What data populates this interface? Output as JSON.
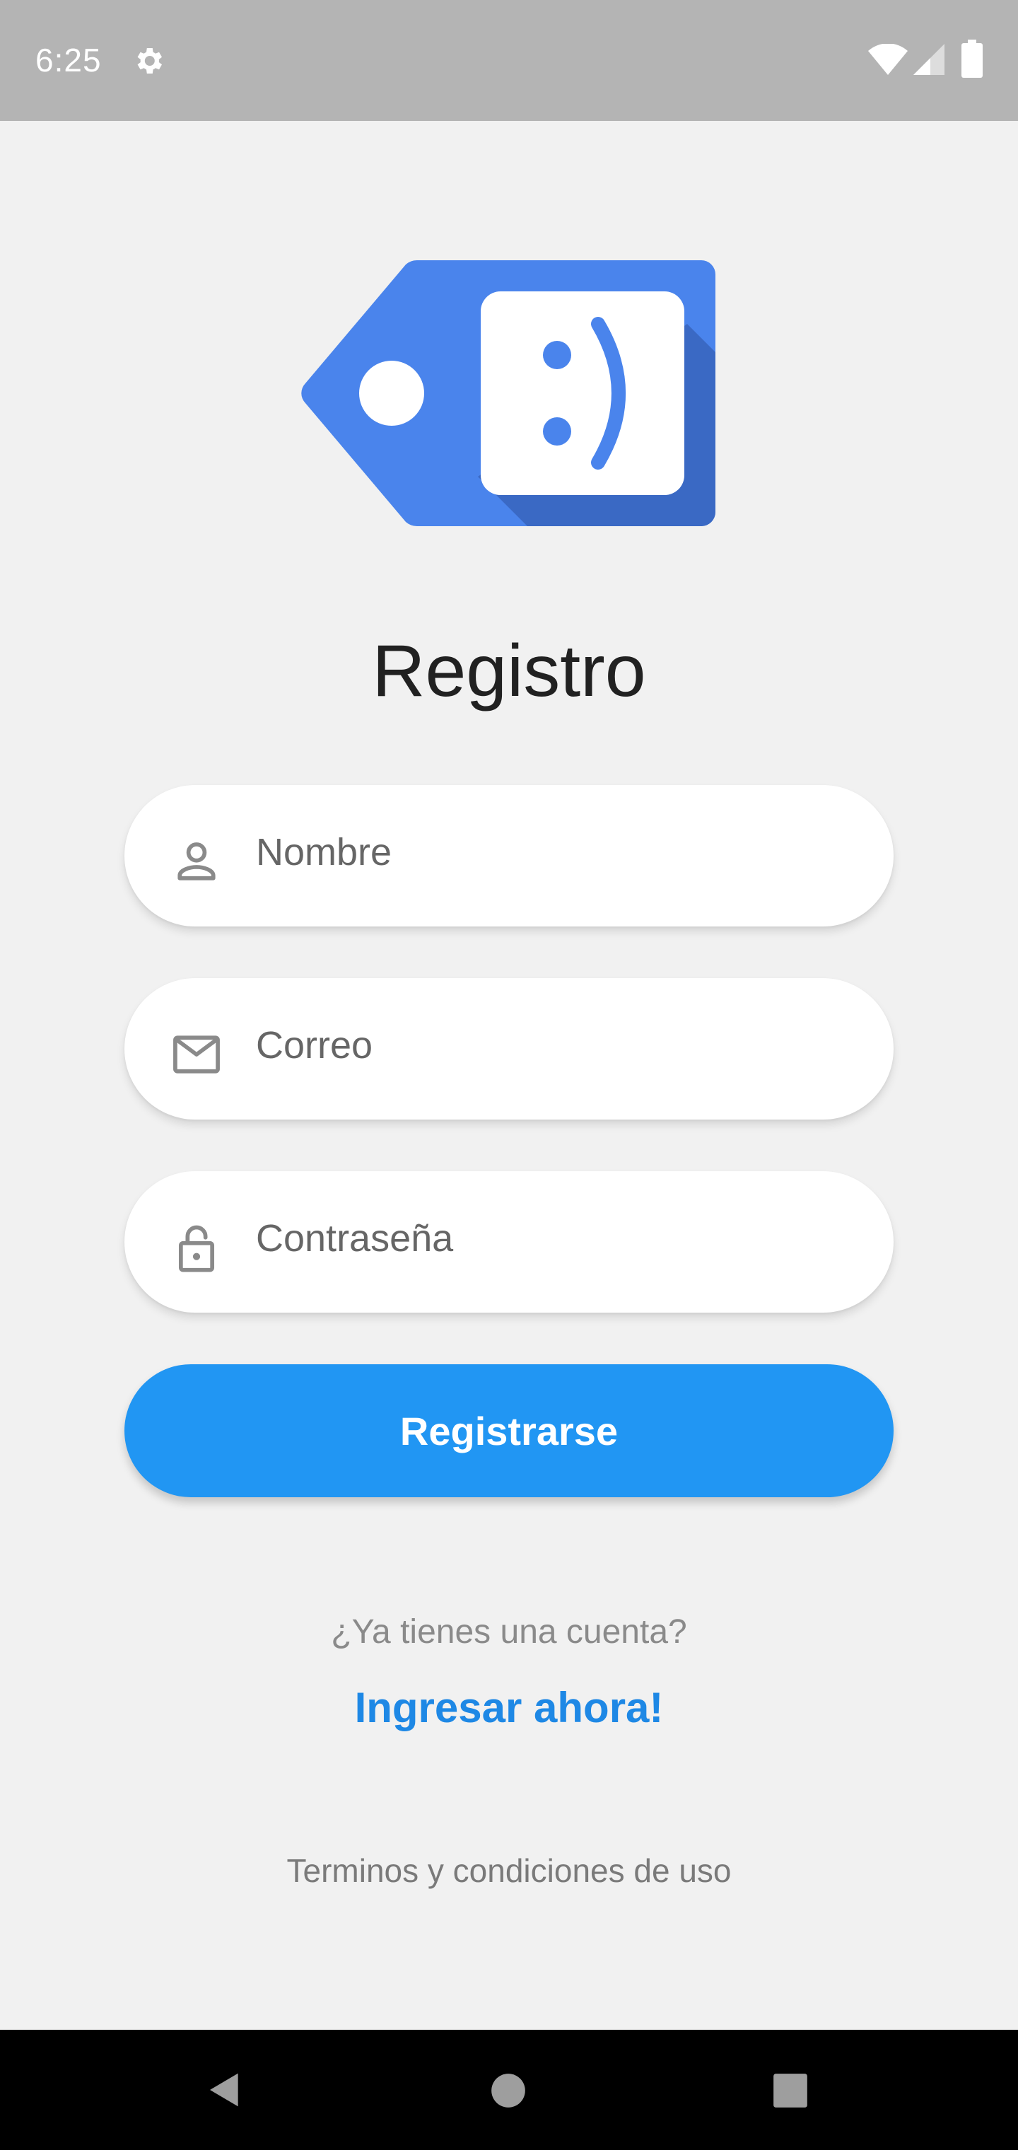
{
  "status_bar": {
    "time": "6:25",
    "icons": [
      "gear-icon",
      "wifi-icon",
      "cell-signal-icon",
      "battery-icon"
    ]
  },
  "logo": {
    "icon": "tag-smiley-logo-icon",
    "face_text": ":)",
    "colors": {
      "primary": "#4a84ec",
      "shadow": "#3a69c4",
      "face": "#ffffff"
    }
  },
  "title": "Registro",
  "form": {
    "name_placeholder": "Nombre",
    "name_icon": "person-icon",
    "email_placeholder": "Correo",
    "email_icon": "mail-icon",
    "password_placeholder": "Contraseña",
    "password_icon": "lock-icon",
    "submit_label": "Registrarse"
  },
  "login_prompt": {
    "question": "¿Ya tienes una cuenta?",
    "link": "Ingresar ahora!"
  },
  "terms": "Terminos y condiciones de uso",
  "colors": {
    "accent": "#2196f3",
    "link": "#1e88e5",
    "background": "#f1f1f1"
  },
  "nav_bar": {
    "icons": [
      "back-icon",
      "home-icon",
      "recents-icon"
    ]
  }
}
